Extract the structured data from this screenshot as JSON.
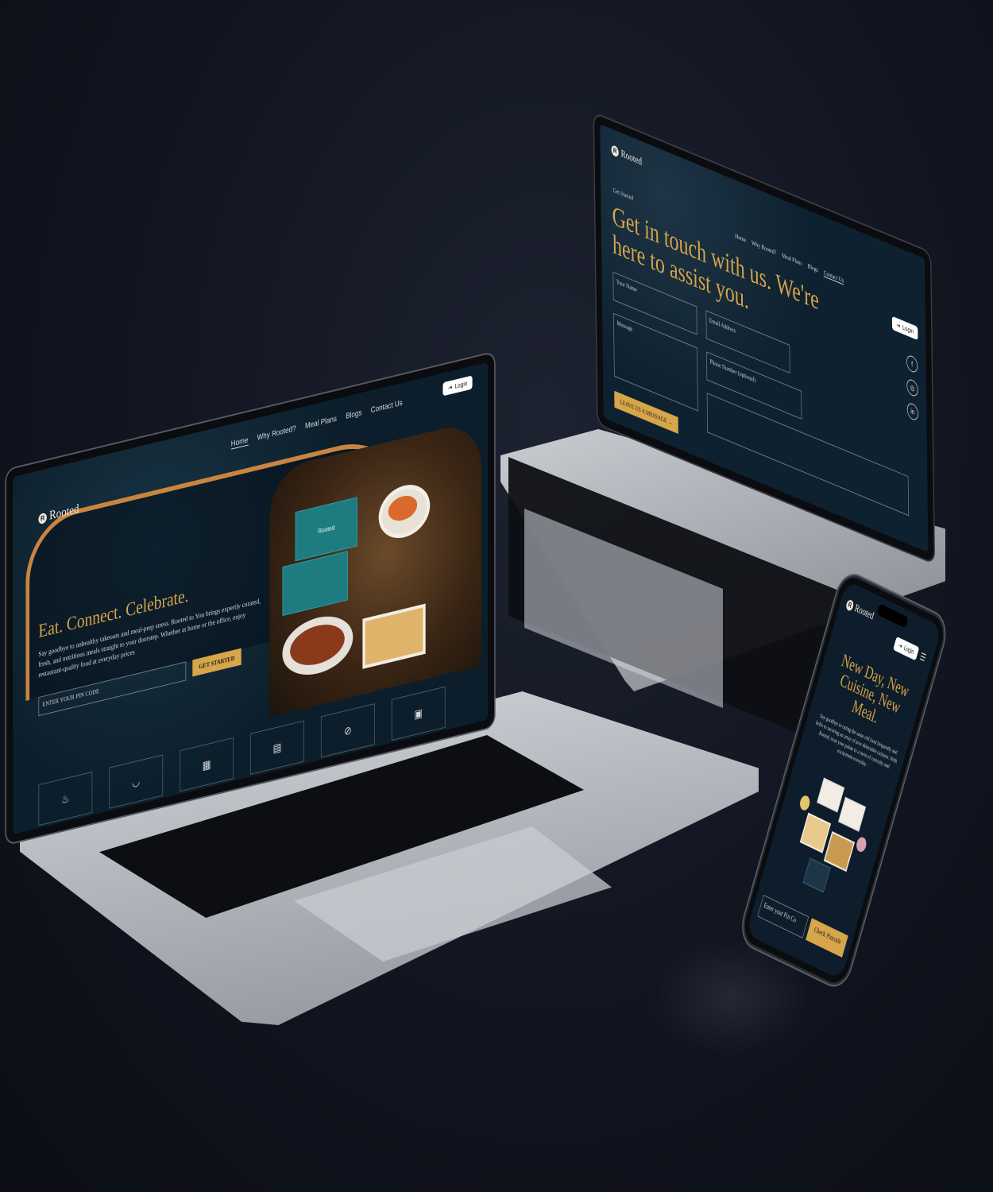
{
  "brand": {
    "name": "Rooted",
    "mark": "R",
    "accent": "#d7a54a",
    "teal": "#1e7c81"
  },
  "home": {
    "nav": [
      "Home",
      "Why Rooted?",
      "Meal Plans",
      "Blogs",
      "Contact Us"
    ],
    "login": "Login",
    "headline": "Eat. Connect. Celebrate.",
    "body": "Say goodbye to unhealthy takeouts and meal-prep stress. Rooted to You brings expertly curated, fresh, and nutritious meals straight to your doorstep. Whether at home or the office, enjoy restaurant-quality food at everyday prices",
    "pin_placeholder": "ENTER YOUR PIN CODE",
    "cta": "GET STARTED",
    "box_label": "Rooted",
    "feature_icons": [
      "steam-bowl-icon",
      "noodle-bowl-icon",
      "calendar-icon",
      "containers-icon",
      "no-sign-icon",
      "delivery-bag-icon"
    ]
  },
  "contact": {
    "breadcrumb": "Get Started",
    "nav": [
      "Home",
      "Why Rooted?",
      "Meal Plans",
      "Blogs",
      "Contact Us"
    ],
    "login": "Login",
    "headline": "Get in touch with us. We're here to assist you.",
    "fields": {
      "name": "Your Name",
      "email": "Email Address",
      "message": "Message",
      "phone": "Phone Number (optional)"
    },
    "submit": "LEAVE US A MESSAGE",
    "socials": [
      "f",
      "◎",
      "in"
    ]
  },
  "mobile": {
    "login": "Login",
    "headline": "New Day, New Cuisine, New Meal.",
    "body": "Say goodbye to eating the same old food frequently and hello to savoring an array of new delectable cuisines. With Rooted, treat your palate to a twist of curiosity and excitement everyday.",
    "pin_placeholder": "Enter your Pin Co",
    "cta": "Check Pincode"
  }
}
